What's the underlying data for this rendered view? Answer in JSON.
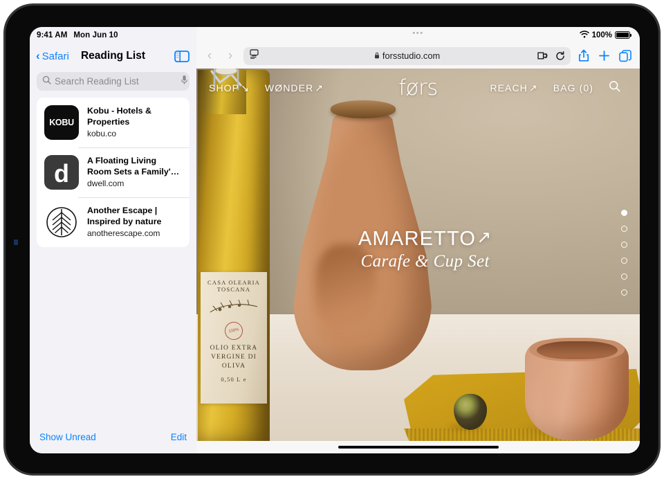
{
  "status_bar": {
    "time": "9:41 AM",
    "date": "Mon Jun 10",
    "battery_percent": "100%",
    "wifi_icon": "wifi-icon",
    "battery_icon": "battery-icon"
  },
  "sidebar": {
    "back_label": "Safari",
    "title": "Reading List",
    "toggle_icon": "sidebar-toggle-icon",
    "search": {
      "placeholder": "Search Reading List",
      "value": "",
      "search_icon": "search-icon",
      "mic_icon": "microphone-icon"
    },
    "items": [
      {
        "icon_text": "KOBU",
        "icon_name": "kobu-favicon",
        "title": "Kobu - Hotels & Properties",
        "url": "kobu.co"
      },
      {
        "icon_text": "d",
        "icon_name": "dwell-favicon",
        "title": "A Floating Living Room Sets a Family's Lake M…",
        "url": "dwell.com"
      },
      {
        "icon_text": "",
        "icon_name": "another-escape-leaf-favicon",
        "title": "Another Escape | Inspired by nature",
        "url": "anotherescape.com"
      }
    ],
    "footer": {
      "show_unread": "Show Unread",
      "edit": "Edit"
    }
  },
  "browser": {
    "multitask_dots": "•••",
    "back_icon": "chevron-left-icon",
    "forward_icon": "chevron-right-icon",
    "page_settings_icon": "page-format-icon",
    "lock_icon": "lock-icon",
    "url": "forsstudio.com",
    "reader_icon": "reader-view-icon",
    "reload_icon": "reload-icon",
    "share_icon": "share-icon",
    "new_tab_icon": "plus-icon",
    "tabs_icon": "tab-overview-icon"
  },
  "website": {
    "nav_left": [
      {
        "label": "SHOP",
        "arrow": "↘"
      },
      {
        "label": "WØNDER",
        "arrow": "↗"
      }
    ],
    "brand": "førs",
    "nav_right": [
      {
        "label": "REACH",
        "arrow": "↗"
      },
      {
        "label": "BAG (0)",
        "arrow": ""
      }
    ],
    "search_icon": "search-icon",
    "hero": {
      "title": "AMARETTO",
      "title_arrow": "↗",
      "subtitle": "Carafe & Cup Set"
    },
    "page_dots": {
      "count": 6,
      "active_index": 0
    },
    "bottle_label": {
      "brand": "CASA OLEARIA TOSCANA",
      "stamp": "100%",
      "description": "OLIO EXTRA VERGINE DI OLIVA",
      "volume": "0,50 L e"
    }
  },
  "home_indicator": "home-indicator",
  "colors": {
    "accent": "#0a84ff",
    "sidebar_bg": "#f2f2f7",
    "card_bg": "#ffffff",
    "wall": "#bfb099",
    "carafe": "#c98c60",
    "cloth": "#c89a18"
  }
}
